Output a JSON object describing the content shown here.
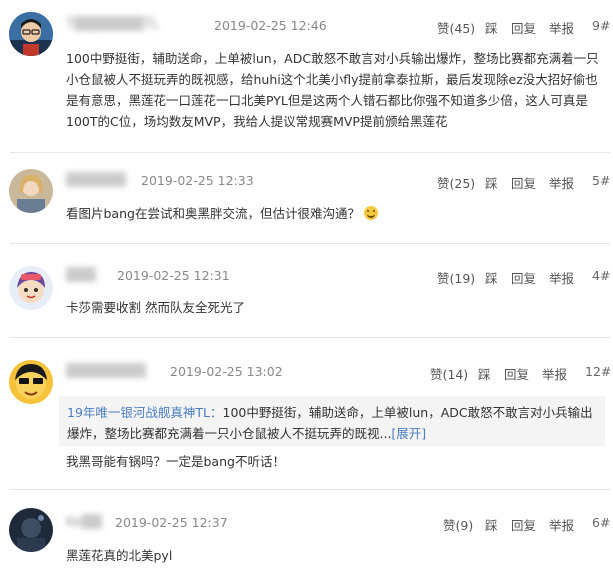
{
  "comments": [
    {
      "username": "T▒▒▒▒▒▒▒TL",
      "time": "2019-02-25 12:46",
      "like": "赞(45)",
      "dislike": "踩",
      "reply": "回复",
      "report": "举报",
      "floor": "9#",
      "content": "100中野挺街，辅助送命，上单被lun，ADC敢怒不敢言对小兵输出爆炸，整场比赛都充满着一只小仓鼠被人不挺玩弄的既视感，给huhi这个北美小fly提前拿泰拉斯，最后发现除ez没大招好偷也是有意思，黑莲花一口莲花一口北美PYL但是这两个人错石都比你强不知道多少倍，这人可真是100T的C位，场均数友MVP，我给人提议常规赛MVP提前颁给黑莲花"
    },
    {
      "username": "▒▒▒▒▒▒",
      "time": "2019-02-25 12:33",
      "like": "赞(25)",
      "dislike": "踩",
      "reply": "回复",
      "report": "举报",
      "floor": "5#",
      "content": "看图片bang在尝试和奥黑胖交流，但估计很难沟通？"
    },
    {
      "username": "▒▒▒",
      "time": "2019-02-25 12:31",
      "like": "赞(19)",
      "dislike": "踩",
      "reply": "回复",
      "report": "举报",
      "floor": "4#",
      "content": "卡莎需要收割 然而队友全死光了"
    },
    {
      "username": "▒▒▒▒▒▒▒▒",
      "time": "2019-02-25 13:02",
      "like": "赞(14)",
      "dislike": "踩",
      "reply": "回复",
      "report": "举报",
      "floor": "12#",
      "quote_name": "19年唯一银河战舰真神TL：",
      "quote_text": "100中野挺街，辅助送命，上单被lun，ADC敢怒不敢言对小兵输出爆炸，整场比赛都充满着一只小仓鼠被人不挺玩弄的既视...",
      "quote_more": "[展开]",
      "content": "我黑哥能有锅吗？一定是bang不听话！"
    },
    {
      "username": "Ke▒▒",
      "time": "2019-02-25 12:37",
      "like": "赞(9)",
      "dislike": "踩",
      "reply": "回复",
      "report": "举报",
      "floor": "6#",
      "content": "黑莲花真的北美pyl"
    }
  ],
  "icons": [
    "avatar-1",
    "avatar-2",
    "avatar-3",
    "avatar-4",
    "avatar-5",
    "grin-emoji-icon"
  ]
}
